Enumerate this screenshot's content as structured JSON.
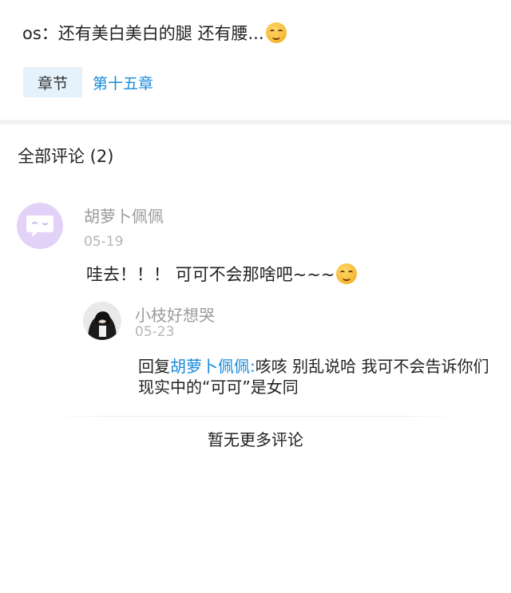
{
  "post": {
    "body_text": "os：还有美白美白的腿 还有腰...",
    "emoji_name": "drooling-face-emoji",
    "chapter_tag": "章节",
    "chapter_link": "第十五章"
  },
  "comments_section": {
    "header": "全部评论 (2)",
    "comments": [
      {
        "username": "胡萝卜佩佩",
        "date": "05-19",
        "text": "哇去！！！ 可可不会那啥吧~~~",
        "emoji_name": "smirking-face-emoji",
        "avatar_icon": "chat-bubble-icon",
        "reply": {
          "username": "小枝好想哭",
          "date": "05-23",
          "prefix": "回复",
          "mention": "胡萝卜佩佩:",
          "text": "咳咳 别乱说哈 我可不会告诉你们现实中的“可可”是女同"
        }
      }
    ],
    "footer": "暂无更多评论"
  },
  "colors": {
    "accent_link": "#1a8ad8",
    "chapter_tag_bg": "#e6f2fb",
    "avatar_bg": "#e3d2f7",
    "muted_text": "#9a9a9a"
  }
}
